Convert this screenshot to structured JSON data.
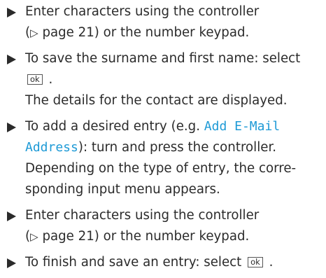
{
  "instructions": {
    "step1": {
      "line1": "Enter characters using the controller",
      "line2_open": "(",
      "page_ref_symbol": "▷",
      "line2_rest": " page 21) or the number keypad."
    },
    "step2": {
      "line1": "To save the surname and first name: select",
      "ok_key": "ok",
      "period": ".",
      "result": "The details for the contact are displayed."
    },
    "step3": {
      "prefix": "To add a desired entry (e.g. ",
      "menu_term_part1": "Add E-Mail",
      "menu_term_part2": "Address",
      "suffix": "): turn and press the controller.",
      "line3": "Depending on the type of entry, the corre-",
      "line4": "sponding input menu appears."
    },
    "step4": {
      "line1": "Enter characters using the controller",
      "line2_open": "(",
      "page_ref_symbol": "▷",
      "line2_rest": " page 21) or the number keypad."
    },
    "step5": {
      "line1": "To finish and save an entry: select",
      "ok_key": "ok",
      "period": "."
    }
  }
}
